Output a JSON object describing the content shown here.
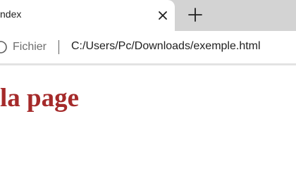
{
  "tab": {
    "title": "ndex",
    "close_icon": "close-icon"
  },
  "new_tab_icon": "plus-icon",
  "address_bar": {
    "scheme_label": "Fichier",
    "url": "C:/Users/Pc/Downloads/exemple.html"
  },
  "page": {
    "heading": "la page",
    "heading_color": "#a52a2a"
  }
}
